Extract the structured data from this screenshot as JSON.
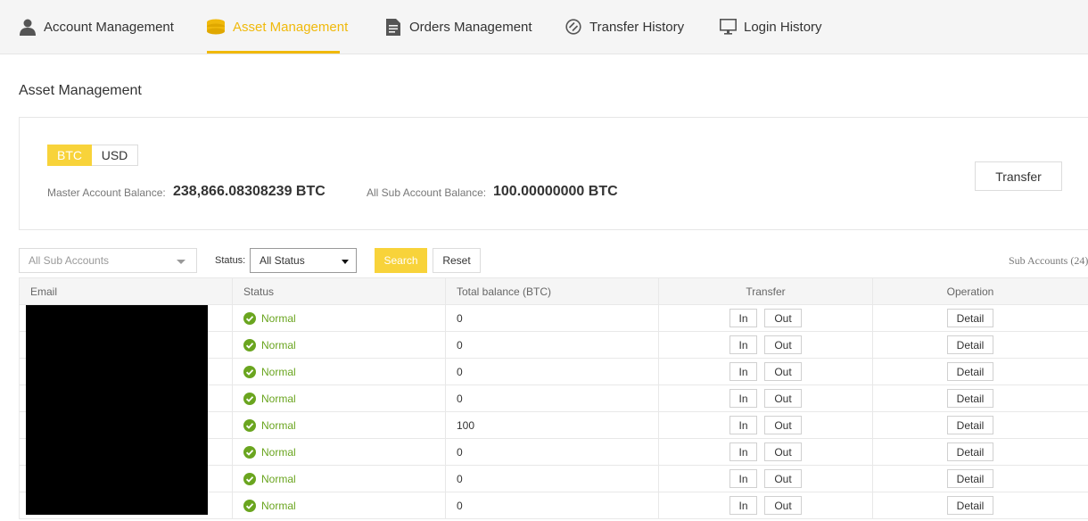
{
  "nav": {
    "tabs": [
      {
        "label": "Account Management",
        "icon": "user-icon"
      },
      {
        "label": "Asset Management",
        "icon": "coins-icon",
        "active": true
      },
      {
        "label": "Orders Management",
        "icon": "document-icon"
      },
      {
        "label": "Transfer History",
        "icon": "transfer-icon"
      },
      {
        "label": "Login History",
        "icon": "monitor-icon"
      }
    ],
    "accent_color": "#f0b90b"
  },
  "page_title": "Asset Management",
  "balances": {
    "currencies": [
      "BTC",
      "USD"
    ],
    "selected_currency": "BTC",
    "master_label": "Master Account Balance:",
    "master_value": "238,866.08308239 BTC",
    "sub_label": "All Sub Account Balance:",
    "sub_value": "100.00000000 BTC",
    "transfer_label": "Transfer"
  },
  "filters": {
    "sub_account_placeholder": "All Sub Accounts",
    "status_label": "Status:",
    "status_value": "All Status",
    "search_label": "Search",
    "reset_label": "Reset",
    "sub_accounts_count": "Sub Accounts (24)"
  },
  "table": {
    "columns": [
      "Email",
      "Status",
      "Total balance (BTC)",
      "Transfer",
      "Operation"
    ],
    "in_label": "In",
    "out_label": "Out",
    "detail_label": "Detail",
    "status_color": "#6aa51f",
    "rows": [
      {
        "status": "Normal",
        "balance": "0"
      },
      {
        "status": "Normal",
        "balance": "0"
      },
      {
        "status": "Normal",
        "balance": "0"
      },
      {
        "status": "Normal",
        "balance": "0"
      },
      {
        "status": "Normal",
        "balance": "100"
      },
      {
        "status": "Normal",
        "balance": "0"
      },
      {
        "status": "Normal",
        "balance": "0"
      },
      {
        "status": "Normal",
        "balance": "0"
      }
    ]
  }
}
